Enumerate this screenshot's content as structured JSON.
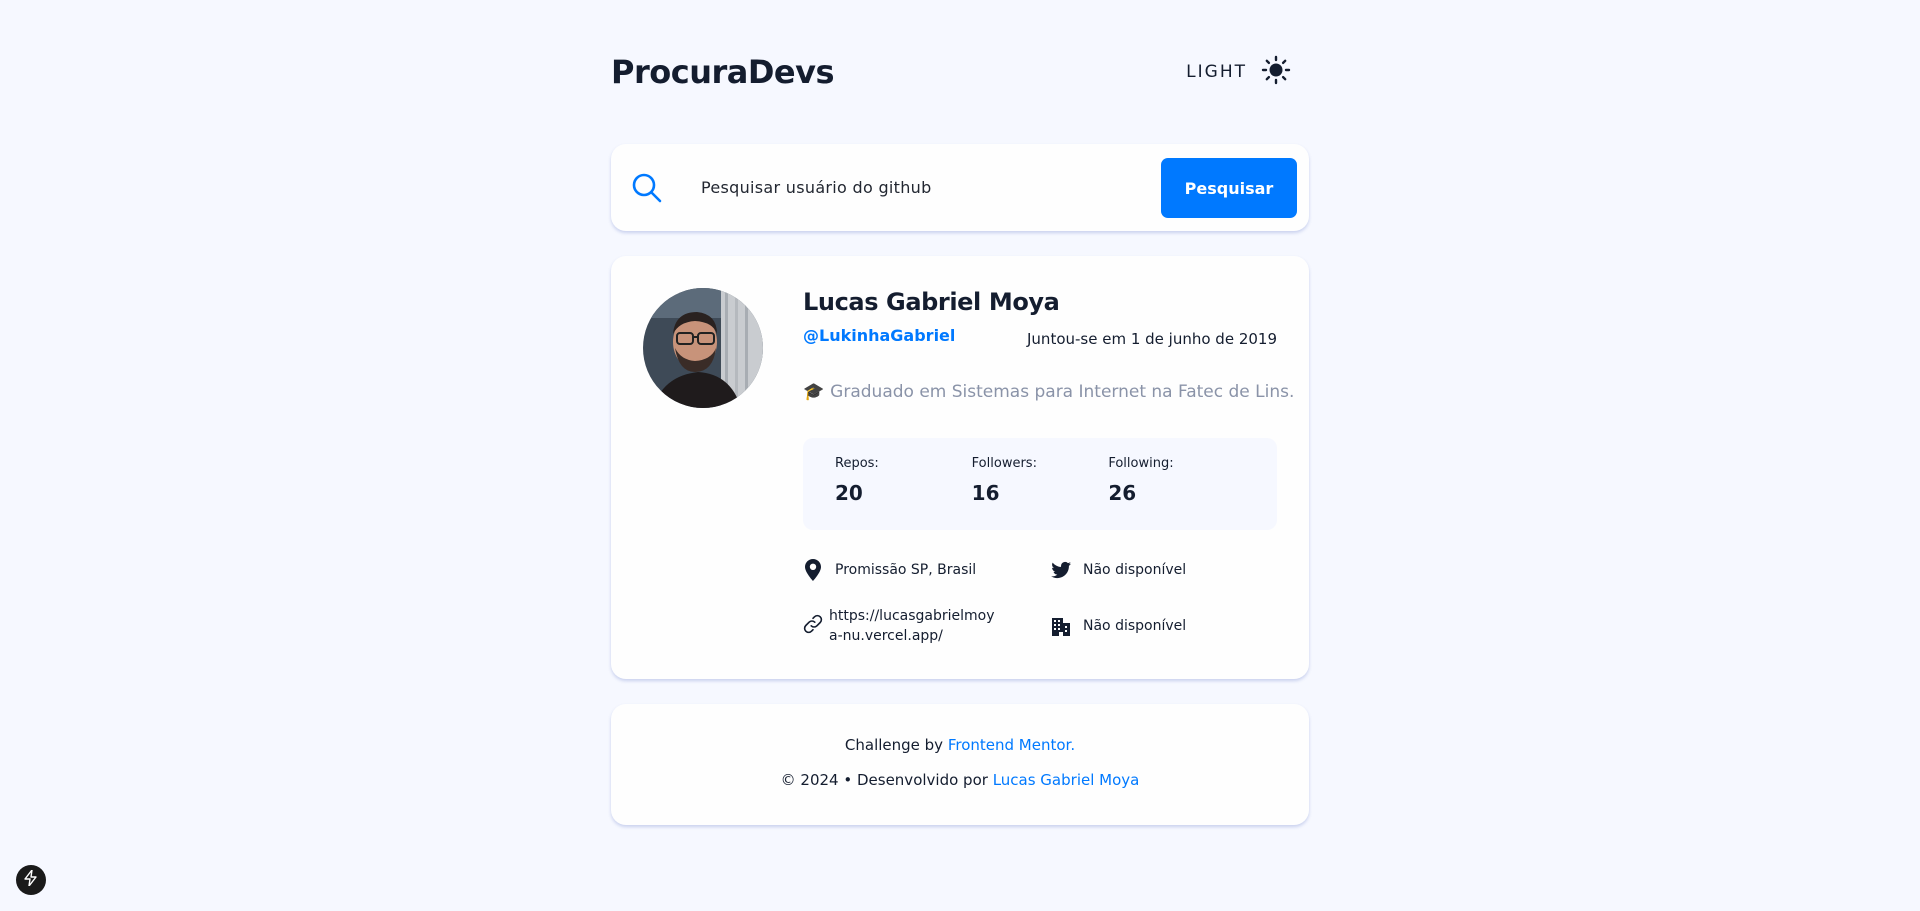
{
  "header": {
    "brand": "ProcuraDevs",
    "theme_label": "LIGHT",
    "theme_icon": "sun-icon"
  },
  "search": {
    "placeholder": "Pesquisar usuário do github",
    "button_label": "Pesquisar",
    "icon": "search-icon"
  },
  "profile": {
    "name": "Lucas Gabriel Moya",
    "login": "@LukinhaGabriel",
    "joined": "Juntou-se em 1 de junho de 2019",
    "bio_emoji": "🎓",
    "bio": "Graduado em Sistemas para Internet na Fatec de Lins.",
    "stats": [
      {
        "label": "Repos:",
        "value": "20"
      },
      {
        "label": "Followers:",
        "value": "16"
      },
      {
        "label": "Following:",
        "value": "26"
      }
    ],
    "location": "Promissão SP, Brasil",
    "twitter": "Não disponível",
    "blog": "https://lucasgabrielmoya-nu.vercel.app/",
    "company": "Não disponível"
  },
  "footer": {
    "challenge_prefix": "Challenge by ",
    "challenge_link": "Frontend Mentor.",
    "dev_prefix": "© 2024 • Desenvolvido por ",
    "dev_link": "Lucas Gabriel Moya"
  },
  "colors": {
    "accent": "#0079ff",
    "background": "#f6f8ff",
    "text": "#141d2f",
    "muted": "#8a93a8"
  }
}
